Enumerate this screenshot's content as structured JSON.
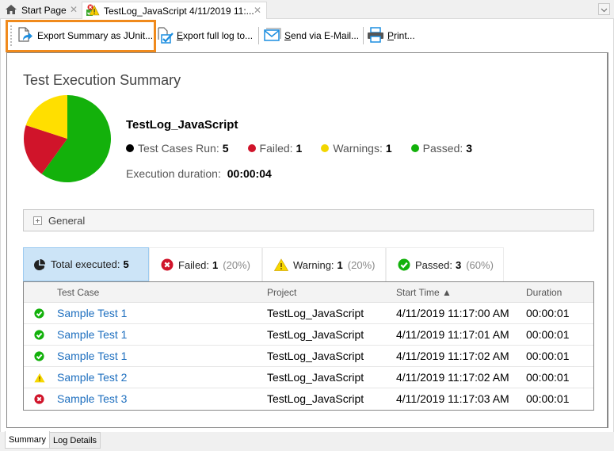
{
  "doc_tabs": [
    {
      "label": "Start Page",
      "icon": "home-icon",
      "active": false
    },
    {
      "label": "TestLog_JavaScript 4/11/2019 11:...",
      "icon": "test-log-icon",
      "active": true
    }
  ],
  "toolbar": {
    "export_junit_label": "Export Summary as JUnit...",
    "export_full_prefix": "E",
    "export_full_rest": "xport full log to...",
    "send_mail_prefix": "S",
    "send_mail_rest": "end via E-Mail...",
    "print_prefix": "P",
    "print_rest": "rint..."
  },
  "summary": {
    "title": "Test Execution Summary",
    "log_name": "TestLog_JavaScript",
    "stats": [
      {
        "label": "Test Cases Run:",
        "value": "5",
        "color": "#000000"
      },
      {
        "label": "Failed:",
        "value": "1",
        "color": "#d0142a"
      },
      {
        "label": "Warnings:",
        "value": "1",
        "color": "#f2d600"
      },
      {
        "label": "Passed:",
        "value": "3",
        "color": "#13b10b"
      }
    ],
    "duration_label": "Execution duration:",
    "duration_value": "00:00:04"
  },
  "chart_data": {
    "type": "pie",
    "title": "",
    "slices": [
      {
        "label": "Passed",
        "value": 3,
        "color": "#13b10b"
      },
      {
        "label": "Failed",
        "value": 1,
        "color": "#d0142a"
      },
      {
        "label": "Warnings",
        "value": 1,
        "color": "#ffdf00"
      }
    ]
  },
  "general": {
    "label": "General"
  },
  "filter_tabs": [
    {
      "label": "Total executed:",
      "count": "5",
      "pct": "",
      "active": true
    },
    {
      "label": "Failed:",
      "count": "1",
      "pct": "(20%)",
      "active": false
    },
    {
      "label": "Warning:",
      "count": "1",
      "pct": "(20%)",
      "active": false
    },
    {
      "label": "Passed:",
      "count": "3",
      "pct": "(60%)",
      "active": false
    }
  ],
  "table": {
    "columns": [
      "Test Case",
      "Project",
      "Start Time ▲",
      "Duration"
    ],
    "rows": [
      {
        "status": "passed",
        "name": "Sample Test 1",
        "project": "TestLog_JavaScript",
        "start": "4/11/2019 11:17:00 AM",
        "duration": "00:00:01"
      },
      {
        "status": "passed",
        "name": "Sample Test 1",
        "project": "TestLog_JavaScript",
        "start": "4/11/2019 11:17:01 AM",
        "duration": "00:00:01"
      },
      {
        "status": "passed",
        "name": "Sample Test 1",
        "project": "TestLog_JavaScript",
        "start": "4/11/2019 11:17:02 AM",
        "duration": "00:00:01"
      },
      {
        "status": "warning",
        "name": "Sample Test 2",
        "project": "TestLog_JavaScript",
        "start": "4/11/2019 11:17:02 AM",
        "duration": "00:00:01"
      },
      {
        "status": "failed",
        "name": "Sample Test 3",
        "project": "TestLog_JavaScript",
        "start": "4/11/2019 11:17:03 AM",
        "duration": "00:00:01"
      }
    ]
  },
  "view_tabs": [
    {
      "label": "Summary",
      "active": true
    },
    {
      "label": "Log Details",
      "active": false
    }
  ]
}
